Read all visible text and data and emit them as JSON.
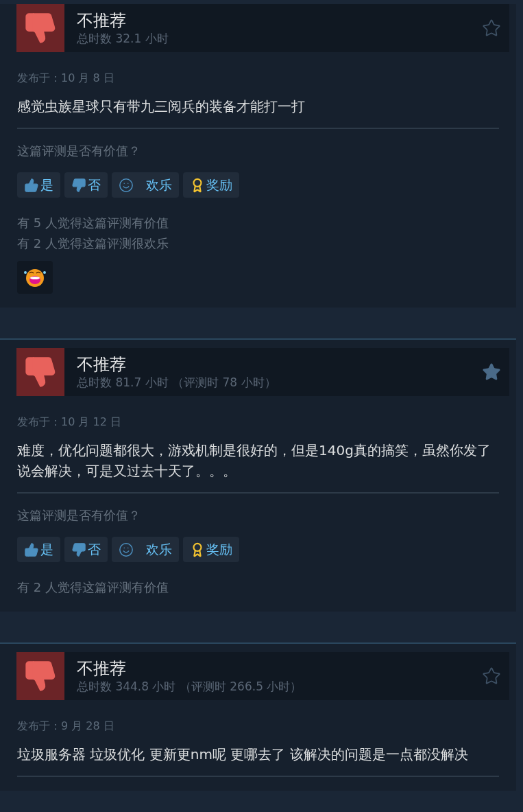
{
  "reviews": [
    {
      "verdict": "不推荐",
      "hours": "总时数 32.1 小时",
      "starred": false,
      "date": "发布于：10 月 8 日",
      "body": "感觉虫族星球只有带九三阅兵的装备才能打一打",
      "question": "这篇评测是否有价值？",
      "buttons": [
        {
          "kind": "yes",
          "label": "是"
        },
        {
          "kind": "no",
          "label": "否"
        },
        {
          "kind": "funny",
          "label": "欢乐"
        },
        {
          "kind": "award",
          "label": "奖励"
        }
      ],
      "counts": [
        "有 5 人觉得这篇评测有价值",
        "有 2 人觉得这篇评测很欢乐"
      ],
      "reactions": [
        {
          "kind": "laugh"
        }
      ]
    },
    {
      "verdict": "不推荐",
      "hours": "总时数 81.7 小时 （评测时 78 小时）",
      "starred": true,
      "date": "发布于：10 月 12 日",
      "body": "难度，优化问题都很大，游戏机制是很好的，但是140g真的搞笑，虽然你发了说会解决，可是又过去十天了。。。",
      "question": "这篇评测是否有价值？",
      "buttons": [
        {
          "kind": "yes",
          "label": "是"
        },
        {
          "kind": "no",
          "label": "否"
        },
        {
          "kind": "funny",
          "label": "欢乐"
        },
        {
          "kind": "award",
          "label": "奖励"
        }
      ],
      "counts": [
        "有 2 人觉得这篇评测有价值"
      ]
    },
    {
      "verdict": "不推荐",
      "hours": "总时数 344.8 小时 （评测时 266.5 小时）",
      "starred": false,
      "date": "发布于：9 月 28 日",
      "body": "垃圾服务器 垃圾优化 更新更nm呢 更哪去了 该解决的问题是一点都没解决"
    }
  ]
}
